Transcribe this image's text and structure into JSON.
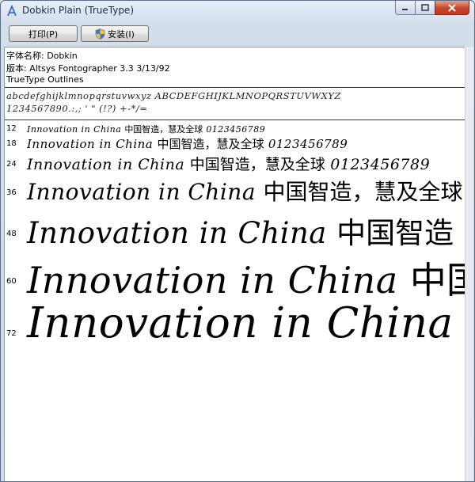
{
  "window": {
    "title": "Dobkin Plain (TrueType)",
    "icon": "font-viewer-icon"
  },
  "caption_buttons": {
    "minimize_icon": "minimize-icon",
    "maximize_icon": "maximize-icon",
    "close_icon": "close-icon"
  },
  "toolbar": {
    "print_label": "打印(P)",
    "install_label": "安装(I)"
  },
  "font_info": {
    "name_line": "字体名称: Dobkin",
    "version_line": "版本: Altsys Fontographer 3.3  3/13/92",
    "outline_line": "TrueType Outlines"
  },
  "charset": {
    "line1": "abcdefghijklmnopqrstuvwxyz ABCDEFGHIJKLMNOPQRSTUVWXYZ",
    "line2": "1234567890.:,; ' \" (!?) +-*/="
  },
  "samples": [
    {
      "size": "12",
      "latin": "Innovation in China",
      "cjk": "中国智造，慧及全球",
      "digits": "0123456789"
    },
    {
      "size": "18",
      "latin": "Innovation in China",
      "cjk": "中国智造，慧及全球",
      "digits": "0123456789"
    },
    {
      "size": "24",
      "latin": "Innovation in China",
      "cjk": "中国智造，慧及全球",
      "digits": "0123456789"
    },
    {
      "size": "36",
      "latin": "Innovation in China",
      "cjk": "中国智造，慧及全球",
      "digits": ""
    },
    {
      "size": "48",
      "latin": "Innovation in China",
      "cjk": "中国智造",
      "digits": ""
    },
    {
      "size": "60",
      "latin": "Innovation in China",
      "cjk": "中国",
      "digits": ""
    },
    {
      "size": "72",
      "latin": "Innovation in China",
      "cjk": "",
      "digits": ""
    }
  ]
}
